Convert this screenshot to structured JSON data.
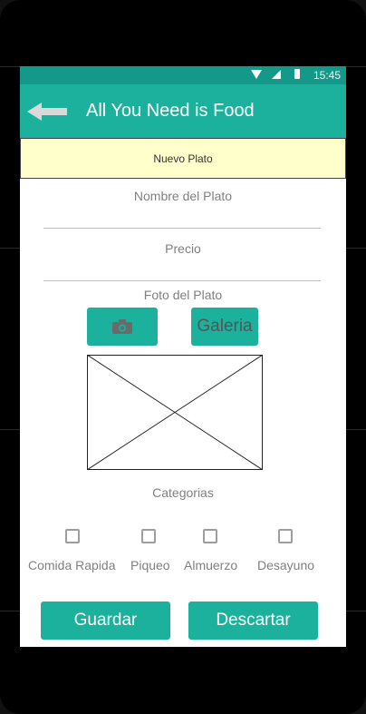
{
  "status_bar": {
    "time": "15:45"
  },
  "app_bar": {
    "title": "All You Need is Food"
  },
  "banner": {
    "label": "Nuevo Plato"
  },
  "form": {
    "name_label": "Nombre del Plato",
    "price_label": "Precio",
    "photo_label": "Foto del Plato",
    "gallery_label": "Galeria",
    "categories_label": "Categorias",
    "categories": [
      "Comida Rapida",
      "Piqueo",
      "Almuerzo",
      "Desayuno"
    ],
    "save_label": "Guardar",
    "discard_label": "Descartar"
  },
  "colors": {
    "accent": "#1bb19d",
    "status_bar": "#14988a",
    "banner": "#ffffcc"
  },
  "icons": {
    "back": "arrow-left",
    "camera": "camera",
    "wifi": "wifi",
    "signal": "cell-signal",
    "battery": "battery"
  }
}
